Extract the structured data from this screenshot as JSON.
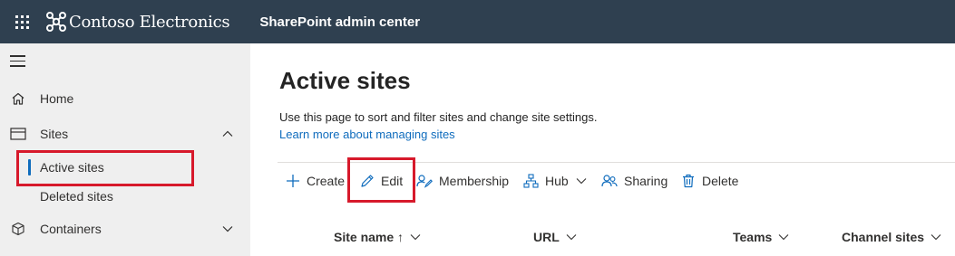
{
  "topbar": {
    "brand_name": "Contoso Electronics",
    "app_name": "SharePoint admin center",
    "background": "#2f4050"
  },
  "nav": {
    "items": [
      {
        "label": "Home",
        "icon": "home-icon"
      },
      {
        "label": "Sites",
        "icon": "sites-icon",
        "expanded": true,
        "children": [
          {
            "label": "Active sites",
            "selected": true
          },
          {
            "label": "Deleted sites"
          }
        ]
      },
      {
        "label": "Containers",
        "icon": "containers-icon",
        "expanded": false
      }
    ]
  },
  "main": {
    "title": "Active sites",
    "description": "Use this page to sort and filter sites and change site settings.",
    "learn_more_link": "Learn more about managing sites"
  },
  "commands": {
    "create": "Create",
    "edit": "Edit",
    "membership": "Membership",
    "hub": "Hub",
    "sharing": "Sharing",
    "delete": "Delete"
  },
  "columns": {
    "site_name": "Site name ↑",
    "url": "URL",
    "teams": "Teams",
    "channel_sites": "Channel sites"
  },
  "colors": {
    "accent": "#0f6cbd",
    "highlight": "#d7192b",
    "nav_background": "#efefef"
  }
}
